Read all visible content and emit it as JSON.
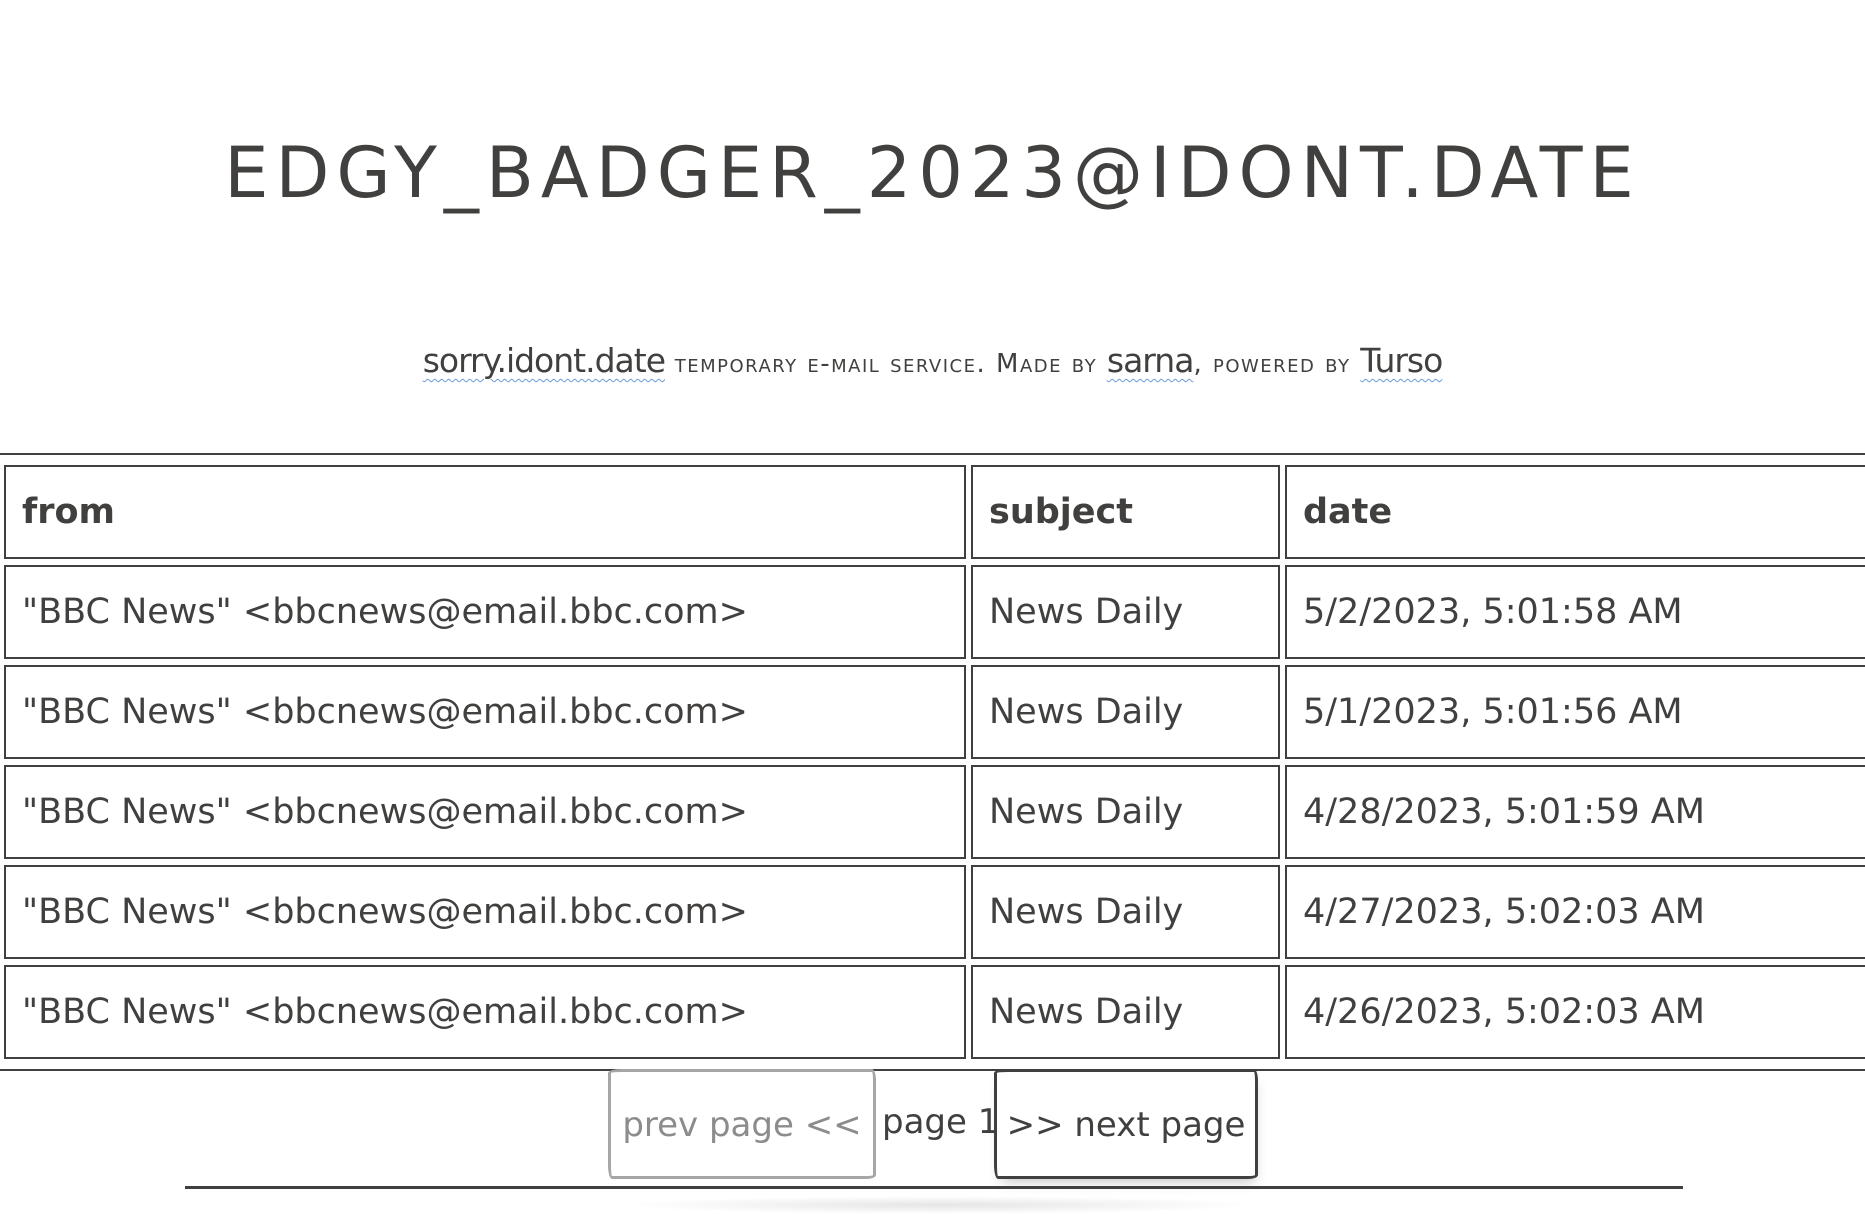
{
  "header": {
    "title": "EDGY_BADGER_2023@IDONT.DATE"
  },
  "tagline": {
    "site_link": "sorry.idont.date",
    "text_part1": "temporary e-mail service. ",
    "made_by_cap": "M",
    "made_by_rest": "ade by ",
    "author_link": "sarna",
    "powered_by": ", powered by ",
    "powered_link": "Turso"
  },
  "mail_table": {
    "columns": [
      "from",
      "subject",
      "date"
    ],
    "rows": [
      {
        "from": "\"BBC News\" <bbcnews@email.bbc.com>",
        "subject": "News Daily",
        "date": "5/2/2023, 5:01:58 AM"
      },
      {
        "from": "\"BBC News\" <bbcnews@email.bbc.com>",
        "subject": "News Daily",
        "date": "5/1/2023, 5:01:56 AM"
      },
      {
        "from": "\"BBC News\" <bbcnews@email.bbc.com>",
        "subject": "News Daily",
        "date": "4/28/2023, 5:01:59 AM"
      },
      {
        "from": "\"BBC News\" <bbcnews@email.bbc.com>",
        "subject": "News Daily",
        "date": "4/27/2023, 5:02:03 AM"
      },
      {
        "from": "\"BBC News\" <bbcnews@email.bbc.com>",
        "subject": "News Daily",
        "date": "4/26/2023, 5:02:03 AM"
      }
    ]
  },
  "pager": {
    "prev_label": "prev page <<",
    "page_label": "page 1",
    "next_label": ">> next page"
  },
  "colors": {
    "text": "#41403e",
    "link_underline": "#6d9bd6",
    "disabled": "#8c8c8a",
    "background": "#ffffff"
  }
}
